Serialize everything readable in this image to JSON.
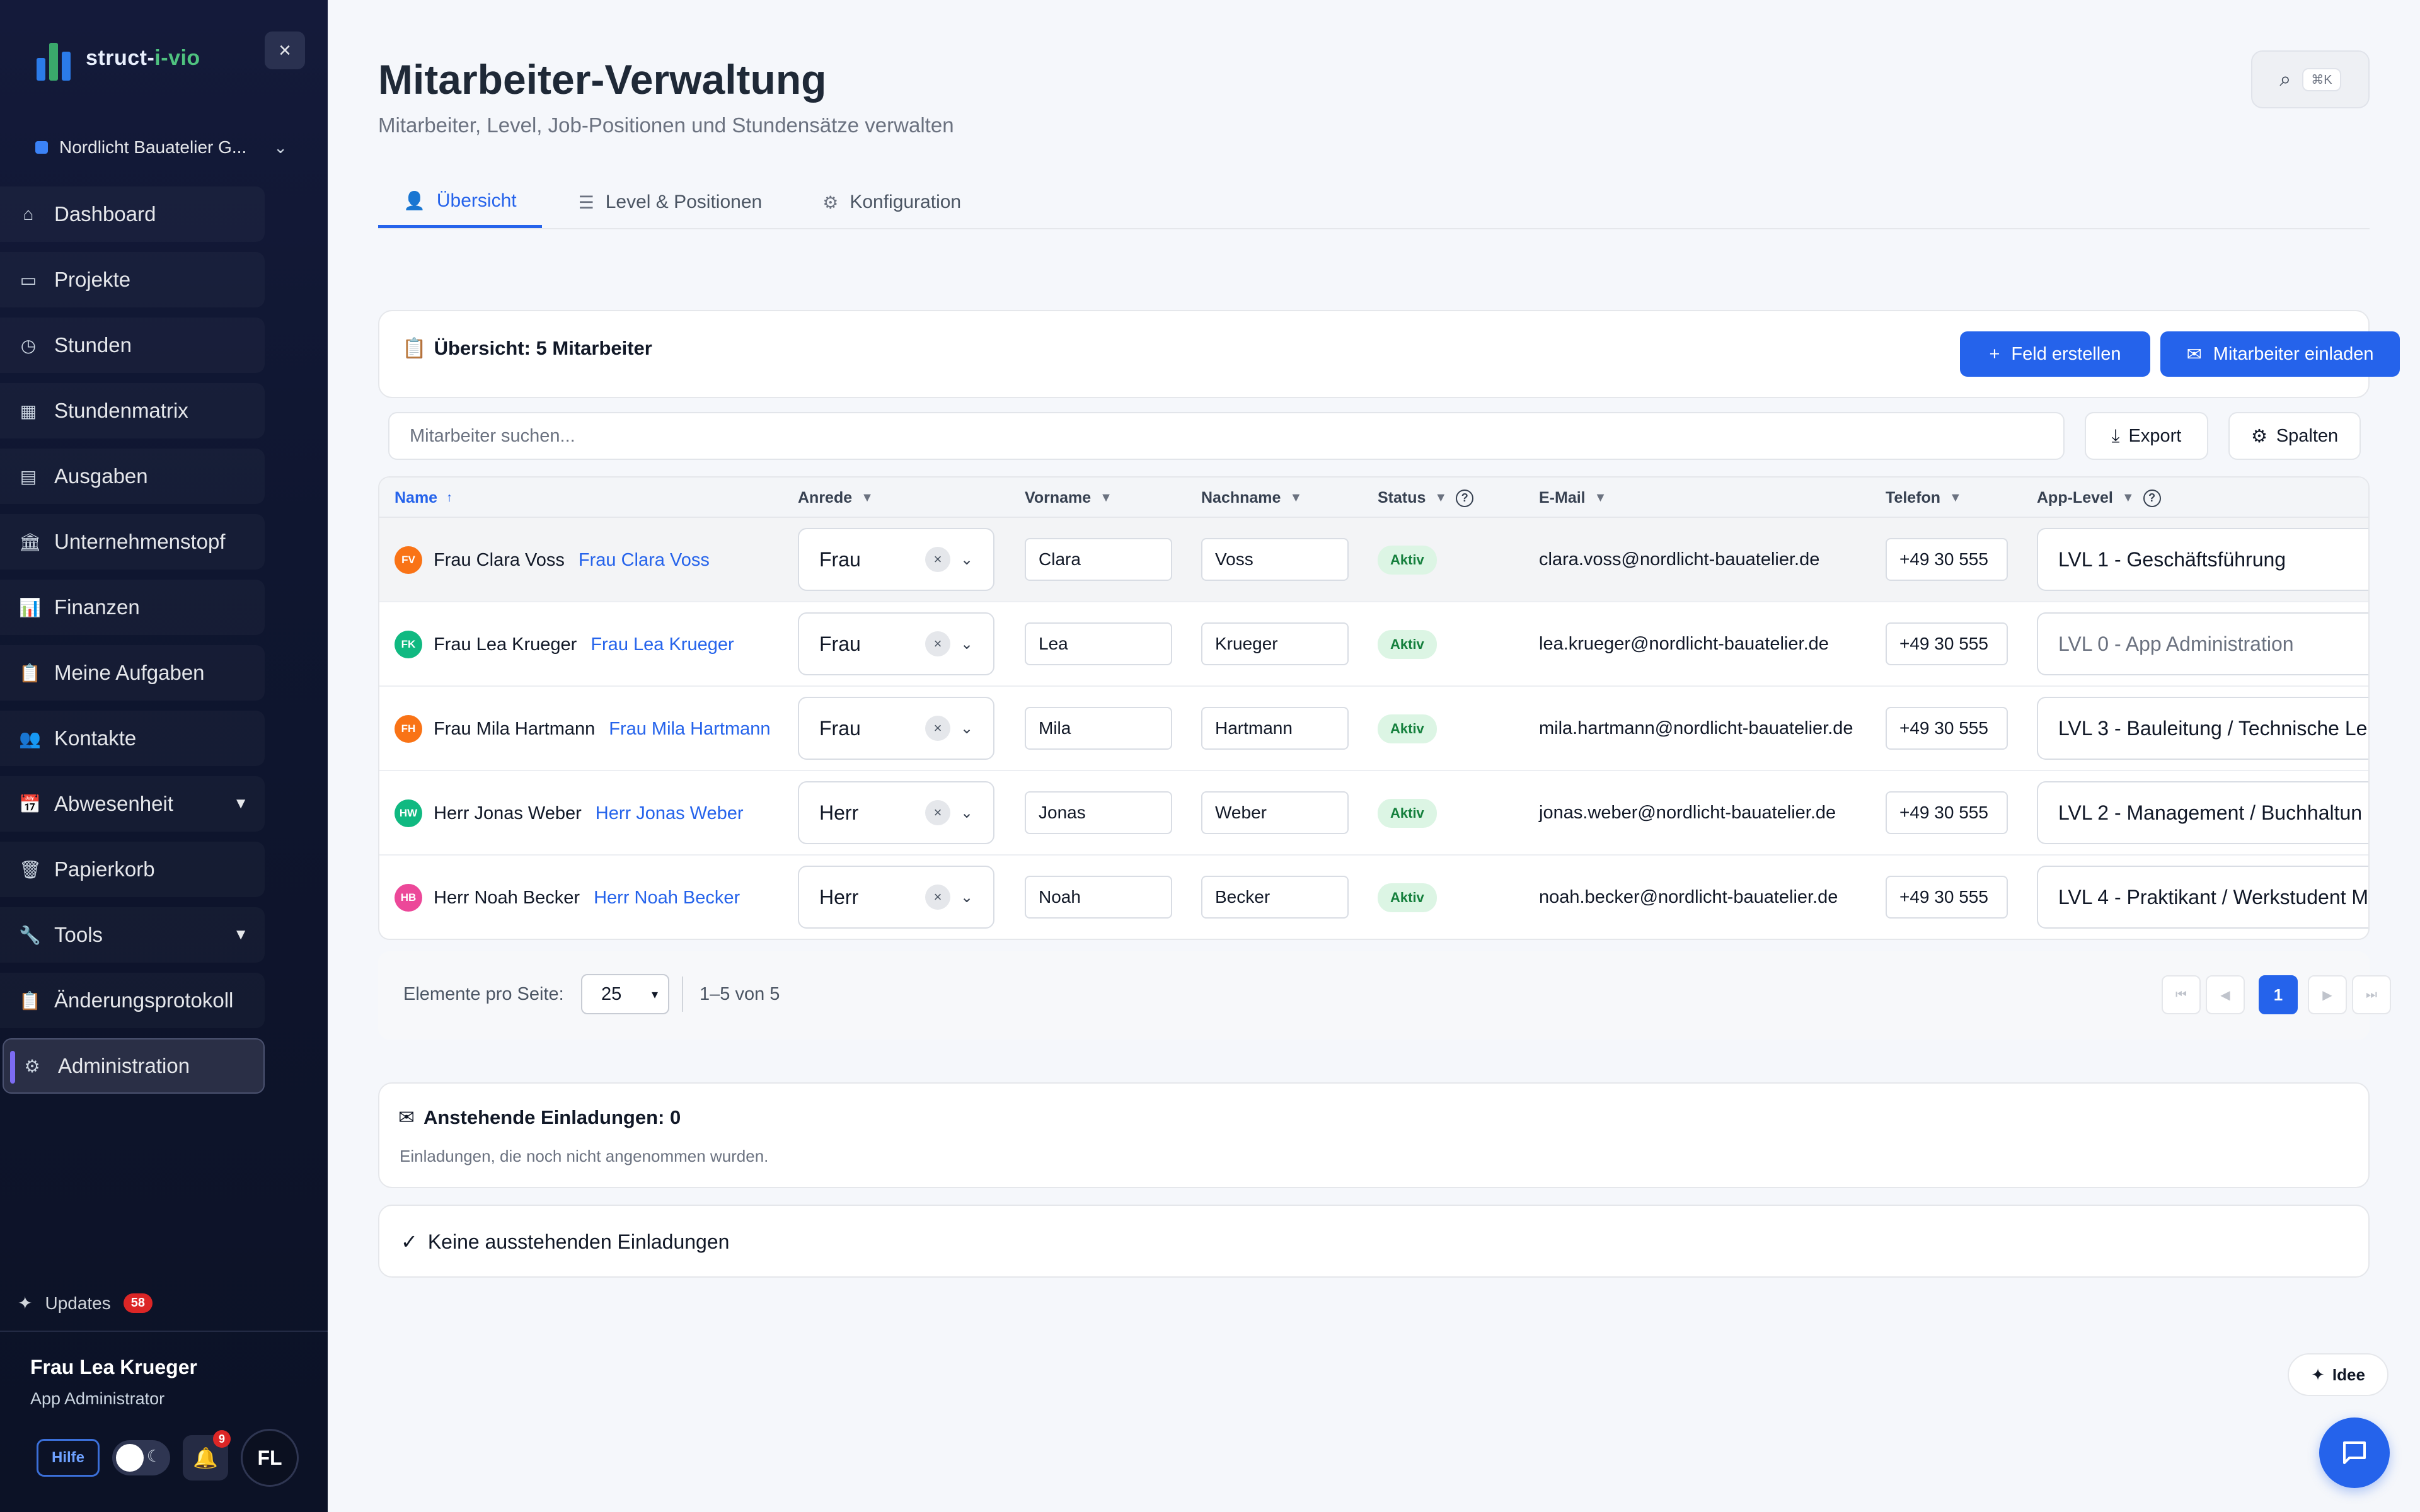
{
  "sidebar": {
    "logo_text_a": "struct-",
    "logo_text_b": "i-vio",
    "close_icon": "×",
    "org_name": "Nordlicht Bauatelier G...",
    "nav": [
      {
        "label": "Dashboard",
        "icon": "⌂"
      },
      {
        "label": "Projekte",
        "icon": "▭"
      },
      {
        "label": "Stunden",
        "icon": "◷"
      },
      {
        "label": "Stundenmatrix",
        "icon": "▦"
      },
      {
        "label": "Ausgaben",
        "icon": "▤"
      },
      {
        "label": "Unternehmenstopf",
        "icon": "🏛"
      },
      {
        "label": "Finanzen",
        "icon": "📊"
      },
      {
        "label": "Meine Aufgaben",
        "icon": "📋"
      },
      {
        "label": "Kontakte",
        "icon": "👥"
      },
      {
        "label": "Abwesenheit",
        "icon": "📅",
        "caret": "▼"
      },
      {
        "label": "Papierkorb",
        "icon": "🗑"
      },
      {
        "label": "Tools",
        "icon": "🔧",
        "caret": "▼"
      },
      {
        "label": "Änderungsprotokoll",
        "icon": "📋"
      },
      {
        "label": "Administration",
        "icon": "⚙"
      }
    ],
    "updates_label": "Updates",
    "updates_count": "58",
    "user_name": "Frau Lea Krueger",
    "user_role": "App Administrator",
    "help_label": "Hilfe",
    "notif_count": "9",
    "avatar_initials": "FL"
  },
  "header": {
    "title": "Mitarbeiter-Verwaltung",
    "subtitle": "Mitarbeiter, Level, Job-Positionen und Stundensätze verwalten",
    "search_shortcut": "⌘K"
  },
  "tabs": [
    {
      "label": "Übersicht"
    },
    {
      "label": "Level & Positionen"
    },
    {
      "label": "Konfiguration"
    }
  ],
  "overview": {
    "title": "Übersicht: 5 Mitarbeiter",
    "create_field_label": "Feld erstellen",
    "invite_label": "Mitarbeiter einladen",
    "search_placeholder": "Mitarbeiter suchen...",
    "export_label": "Export",
    "columns_label": "Spalten"
  },
  "table": {
    "headers": {
      "name": "Name",
      "salutation": "Anrede",
      "firstname": "Vorname",
      "lastname": "Nachname",
      "status": "Status",
      "email": "E-Mail",
      "phone": "Telefon",
      "level": "App-Level"
    },
    "rows": [
      {
        "initials": "FV",
        "avatar_color": "#f97316",
        "name": "Frau Clara Voss",
        "link": "Frau Clara Voss",
        "salutation": "Frau",
        "firstname": "Clara",
        "lastname": "Voss",
        "status": "Aktiv",
        "email": "clara.voss@nordlicht-bauatelier.de",
        "phone": "+49 30 555",
        "level": "LVL 1 - Geschäftsführung"
      },
      {
        "initials": "FK",
        "avatar_color": "#10b981",
        "name": "Frau Lea Krueger",
        "link": "Frau Lea Krueger",
        "salutation": "Frau",
        "firstname": "Lea",
        "lastname": "Krueger",
        "status": "Aktiv",
        "email": "lea.krueger@nordlicht-bauatelier.de",
        "phone": "+49 30 555",
        "level": "LVL 0 - App Administration"
      },
      {
        "initials": "FH",
        "avatar_color": "#f97316",
        "name": "Frau Mila Hartmann",
        "link": "Frau Mila Hartmann",
        "salutation": "Frau",
        "firstname": "Mila",
        "lastname": "Hartmann",
        "status": "Aktiv",
        "email": "mila.hartmann@nordlicht-bauatelier.de",
        "phone": "+49 30 555",
        "level": "LVL 3 - Bauleitung / Technische Le"
      },
      {
        "initials": "HW",
        "avatar_color": "#10b981",
        "name": "Herr Jonas Weber",
        "link": "Herr Jonas Weber",
        "salutation": "Herr",
        "firstname": "Jonas",
        "lastname": "Weber",
        "status": "Aktiv",
        "email": "jonas.weber@nordlicht-bauatelier.de",
        "phone": "+49 30 555",
        "level": "LVL 2 - Management / Buchhaltun"
      },
      {
        "initials": "HB",
        "avatar_color": "#ec4899",
        "name": "Herr Noah Becker",
        "link": "Herr Noah Becker",
        "salutation": "Herr",
        "firstname": "Noah",
        "lastname": "Becker",
        "status": "Aktiv",
        "email": "noah.becker@nordlicht-bauatelier.de",
        "phone": "+49 30 555",
        "level": "LVL 4 - Praktikant / Werkstudent M"
      }
    ]
  },
  "pagination": {
    "per_page_label": "Elemente pro Seite:",
    "per_page_value": "25",
    "range": "1–5 von 5",
    "current_page": "1"
  },
  "pending": {
    "title": "Anstehende Einladungen: 0",
    "description": "Einladungen, die noch nicht angenommen wurden.",
    "empty": "Keine ausstehenden Einladungen"
  },
  "floating": {
    "idea_label": "Idee"
  },
  "colors": {
    "primary": "#2563eb",
    "sidebar_bg": "#0f1630",
    "status_bg": "#dcf5e4",
    "status_text": "#15803d"
  }
}
